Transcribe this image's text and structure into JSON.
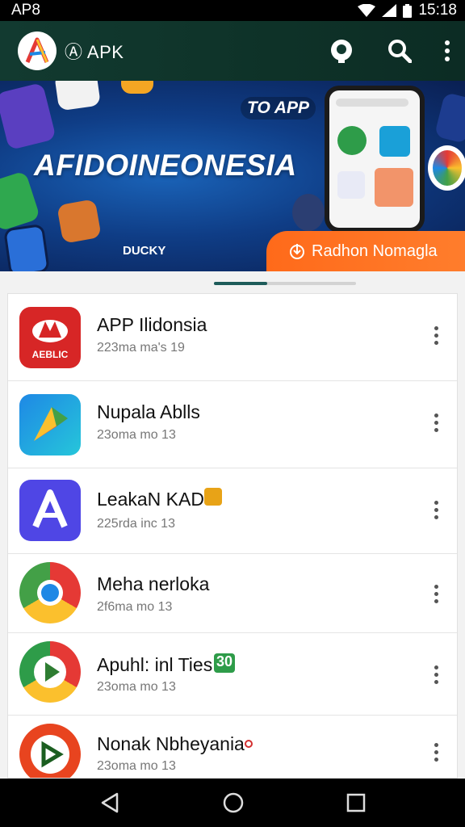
{
  "status_bar": {
    "left_text": "AP8",
    "time": "15:18"
  },
  "app_bar": {
    "title": "Ⓐ APK"
  },
  "banner": {
    "tag": "TO APP",
    "headline": "AFIDOINEONESIA",
    "small_text": "DUCKY",
    "cta": "Radhon Nomagla"
  },
  "apps": [
    {
      "name": "APP Ilidonsia",
      "meta": "223ma ma's 19",
      "icon": "red-logo-icon",
      "icon_text": "AEBLIC"
    },
    {
      "name": "Nupala Ablls",
      "meta": "23oma mo 13",
      "icon": "blue-arrow-icon"
    },
    {
      "name": "LeakaN KAD",
      "meta": "225rda inc 13",
      "icon": "purple-a-icon"
    },
    {
      "name": "Meha nerloka",
      "meta": "2f6ma mo 13",
      "icon": "chrome-like-icon"
    },
    {
      "name": "Apuhl: inl Ties",
      "meta": "23oma mo 13",
      "icon": "play-like-icon",
      "badge": "30"
    },
    {
      "name": "Nonak Nbheyania",
      "meta": "23oma mo 13",
      "icon": "orange-play-icon"
    }
  ],
  "colors": {
    "app_bar": "#123a30",
    "cta": "#ff6a1a",
    "indicator": "#1e5c5a"
  }
}
